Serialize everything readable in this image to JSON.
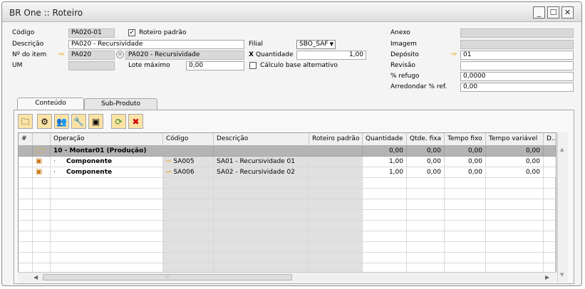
{
  "window": {
    "title": "BR One :: Roteiro",
    "controls": [
      "_",
      "☐",
      "✕"
    ]
  },
  "header": {
    "codigo_label": "Código",
    "codigo_value": "PA020-01",
    "roteiro_padrao_label": "Roteiro padrão",
    "roteiro_padrao_checked": true,
    "descricao_label": "Descrição",
    "descricao_value": "PA020 - Recursividade",
    "filial_label": "Filial",
    "filial_value": "SBO_SAF",
    "item_label": "Nº do item",
    "item_code": "PA020",
    "item_desc": "PA020 - Recursividade",
    "quantidade_mark": "X",
    "quantidade_label": "Quantidade",
    "quantidade_value": "1,00",
    "um_label": "UM",
    "lote_label": "Lote máximo",
    "lote_value": "0,00",
    "calculo_label": "Cálculo base alternativo",
    "calculo_checked": false,
    "anexo_label": "Anexo",
    "imagem_label": "Imagem",
    "deposito_label": "Depósito",
    "deposito_value": "01",
    "revisao_label": "Revisão",
    "refugo_label": "% refugo",
    "refugo_value": "0,0000",
    "arredondar_label": "Arredondar % ref.",
    "arredondar_value": "0,00"
  },
  "tabs": [
    "Conteúdo",
    "Sub-Produto"
  ],
  "toolbar": {
    "icons": [
      "folder-icon",
      "gear-icon",
      "users-icon",
      "wrench-icon",
      "cubes-icon",
      "refresh-icon",
      "delete-icon"
    ]
  },
  "grid": {
    "columns": [
      "#",
      "",
      "Operação",
      "Código",
      "Descrição",
      "Roteiro padrão",
      "Quantidade",
      "Qtde. fixa",
      "Tempo fixo",
      "Tempo variável",
      "D.."
    ],
    "group_row": {
      "operacao": "10 - Montar01 (Produção)",
      "quantidade": "0,00",
      "qtde_fixa": "0,00",
      "tempo_fixo": "0,00",
      "tempo_variavel": "0,00"
    },
    "rows": [
      {
        "bullet": "·",
        "operacao": "Componente",
        "codigo": "SA005",
        "descricao": "SA01 - Recursividade 01",
        "quantidade": "1,00",
        "qtde_fixa": "0,00",
        "tempo_fixo": "0,00",
        "tempo_variavel": "0,00"
      },
      {
        "bullet": "·",
        "operacao": "Componente",
        "codigo": "SA006",
        "descricao": "SA02 - Recursividade 02",
        "quantidade": "1,00",
        "qtde_fixa": "0,00",
        "tempo_fixo": "0,00",
        "tempo_variavel": "0,00"
      }
    ],
    "scroll_grip": ":::"
  },
  "colors": {
    "link_arrow": "#e2a400",
    "group_row_bg": "#b4b4b4",
    "toolbar_btn_bg": "#fbe3a6"
  }
}
